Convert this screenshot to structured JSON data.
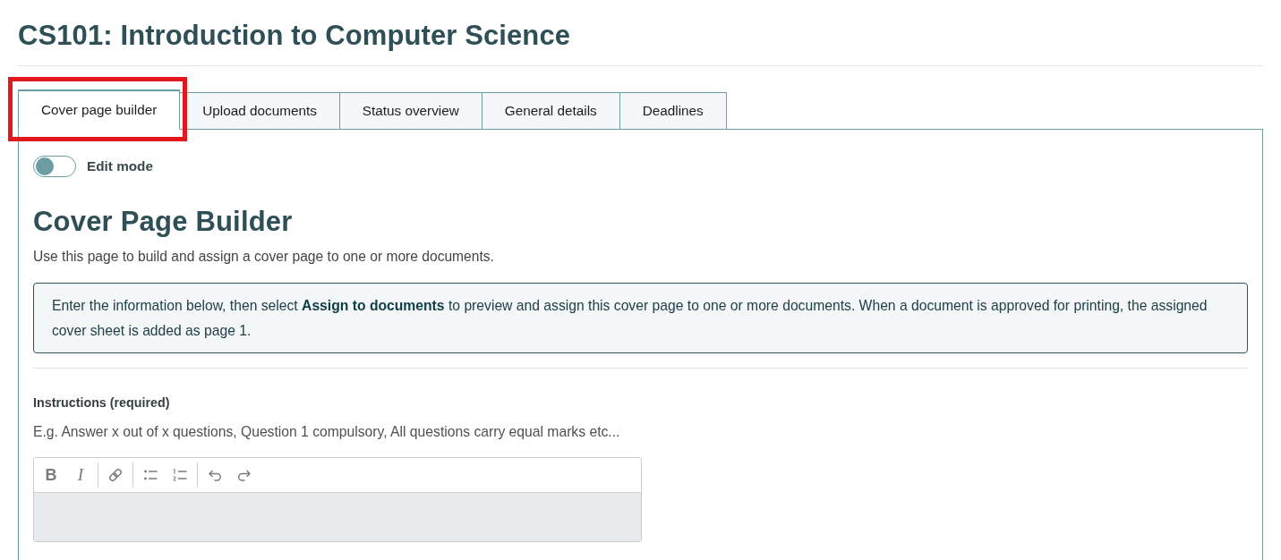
{
  "page": {
    "title": "CS101: Introduction to Computer Science"
  },
  "tabs": [
    {
      "label": "Cover page builder",
      "selected": true,
      "highlighted": true
    },
    {
      "label": "Upload documents",
      "selected": false,
      "highlighted": false
    },
    {
      "label": "Status overview",
      "selected": false,
      "highlighted": false
    },
    {
      "label": "General details",
      "selected": false,
      "highlighted": false
    },
    {
      "label": "Deadlines",
      "selected": false,
      "highlighted": false
    }
  ],
  "panel": {
    "edit_mode": {
      "label": "Edit mode",
      "on": false
    },
    "heading": "Cover Page Builder",
    "description": "Use this page to build and assign a cover page to one or more documents.",
    "info": "Enter the information below, then select **Assign to documents** to preview and assign this cover page to one or more documents. When a document is approved for printing, the assigned cover sheet is added as page 1.",
    "instructions": {
      "label": "Instructions (required)",
      "help_text": "E.g. Answer x out of x questions, Question 1 compulsory, All questions carry equal marks etc...",
      "editor": {
        "disabled": true,
        "toolbar": [
          {
            "buttons": [
              {
                "kind": "bold",
                "label": "B"
              },
              {
                "kind": "italic",
                "label": "I"
              }
            ]
          },
          {
            "buttons": [
              {
                "kind": "link"
              }
            ]
          },
          {
            "buttons": [
              {
                "kind": "bullets"
              },
              {
                "kind": "numbered"
              }
            ]
          },
          {
            "buttons": [
              {
                "kind": "undo"
              },
              {
                "kind": "redo"
              }
            ]
          }
        ]
      }
    }
  }
}
